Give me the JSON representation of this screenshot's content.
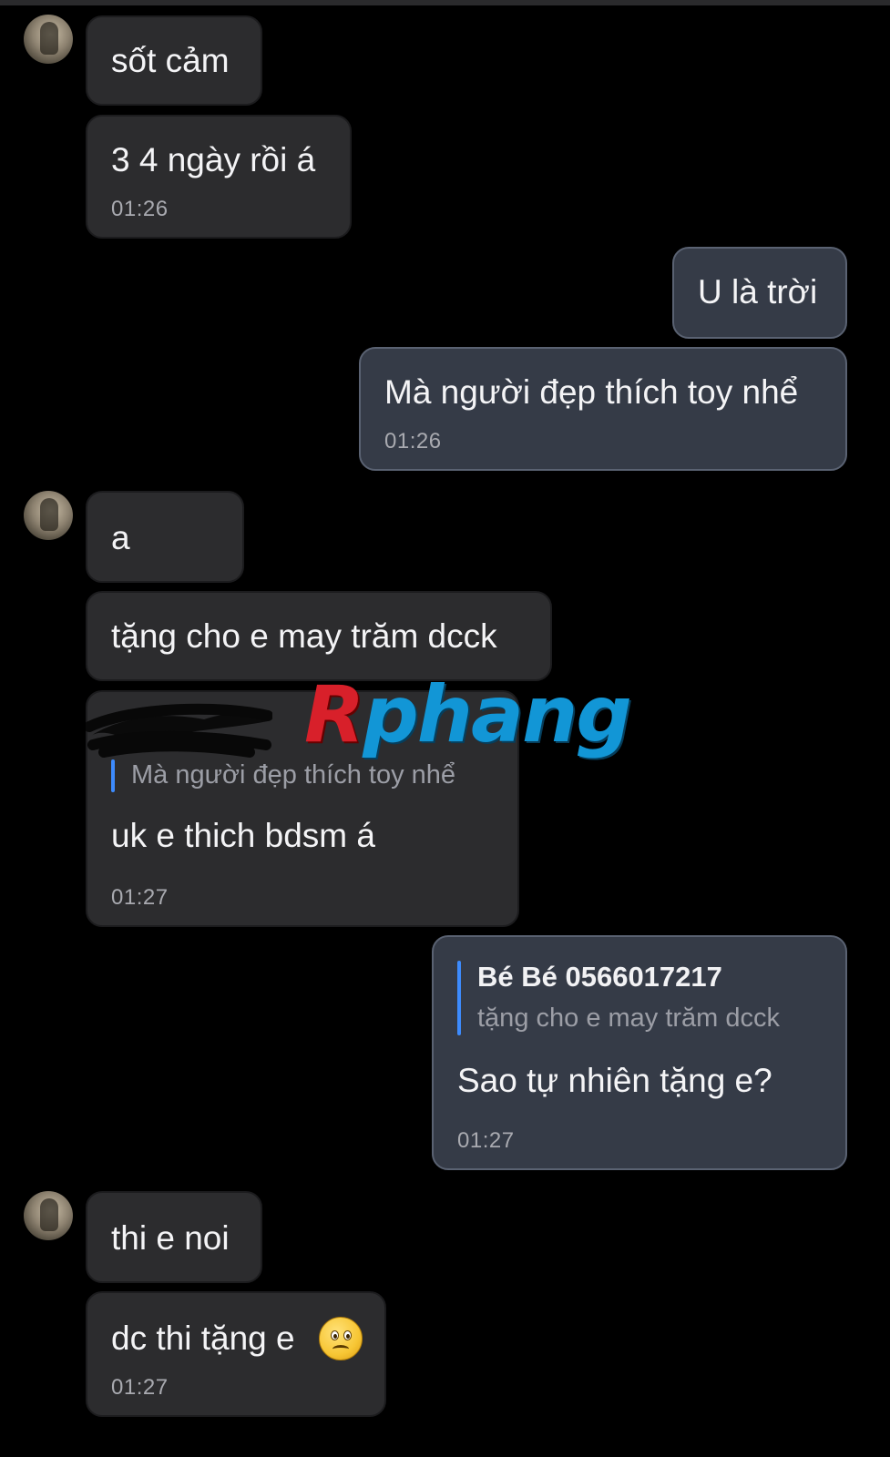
{
  "contact": {
    "avatar_icon": "user-avatar-icon"
  },
  "watermark": {
    "first_letter": "R",
    "rest": "phang"
  },
  "messages": [
    {
      "direction": "incoming",
      "text": "sốt cảm"
    },
    {
      "direction": "incoming",
      "text": "3 4 ngày rồi á",
      "time": "01:26"
    },
    {
      "direction": "outgoing",
      "text": "U là trời"
    },
    {
      "direction": "outgoing",
      "text": "Mà người đẹp thích toy nhể",
      "time": "01:26"
    },
    {
      "direction": "incoming",
      "text": "a"
    },
    {
      "direction": "incoming",
      "text": "tặng cho e may trăm dcck"
    },
    {
      "direction": "incoming",
      "reply_to": {
        "text": "Mà người đẹp thích toy nhể"
      },
      "text": "uk e thich bdsm á",
      "time": "01:27"
    },
    {
      "direction": "outgoing",
      "reply_to": {
        "name": "Bé Bé 0566017217",
        "text": "tặng cho e may trăm dcck"
      },
      "text": "Sao tự nhiên tặng e?",
      "time": "01:27"
    },
    {
      "direction": "incoming",
      "text": "thi e noi"
    },
    {
      "direction": "incoming",
      "text": "dc thi tặng e",
      "emoji": "frowning-face-emoji",
      "time": "01:27"
    }
  ]
}
